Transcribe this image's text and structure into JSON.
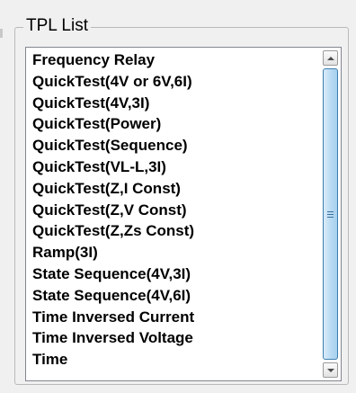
{
  "groupbox": {
    "title": "TPL List"
  },
  "list": {
    "items": [
      "Frequency Relay",
      "QuickTest(4V or 6V,6I)",
      "QuickTest(4V,3I)",
      "QuickTest(Power)",
      "QuickTest(Sequence)",
      "QuickTest(VL-L,3I)",
      "QuickTest(Z,I Const)",
      "QuickTest(Z,V Const)",
      "QuickTest(Z,Zs Const)",
      "Ramp(3I)",
      "State Sequence(4V,3I)",
      "State Sequence(4V,6I)",
      "Time Inversed Current",
      "Time Inversed Voltage",
      "Time"
    ]
  },
  "scrollbar": {
    "up_icon": "arrow-up-icon",
    "down_icon": "arrow-down-icon",
    "grip_icon": "grip-icon"
  },
  "colors": {
    "background": "#f0f0f0",
    "list_background": "#ffffff",
    "thumb": "#b8daf3",
    "thumb_border": "#3c7fb1"
  }
}
